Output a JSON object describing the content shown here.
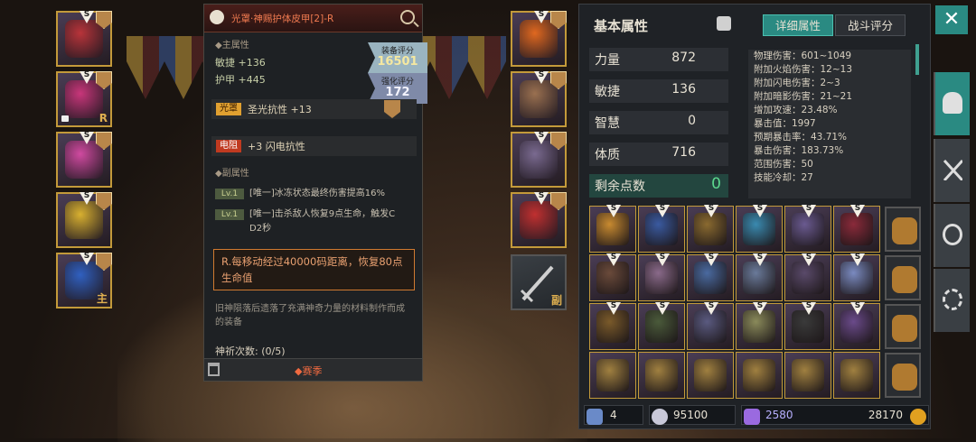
{
  "equipped_left": [
    {
      "name": "helmet",
      "badge": "S",
      "shield": true,
      "color": "#b8343a",
      "locked": false,
      "tag": ""
    },
    {
      "name": "armor",
      "badge": "S",
      "shield": true,
      "color": "#c8367a",
      "locked": true,
      "tag": "R"
    },
    {
      "name": "robe",
      "badge": "S",
      "shield": true,
      "color": "#d04aa0",
      "locked": false,
      "tag": ""
    },
    {
      "name": "axe",
      "badge": "S",
      "shield": true,
      "color": "#d8b030",
      "locked": false,
      "tag": ""
    },
    {
      "name": "mace",
      "badge": "S",
      "shield": true,
      "color": "#3060c0",
      "locked": false,
      "tag": "主"
    }
  ],
  "equipped_right": [
    {
      "name": "amulet",
      "badge": "S",
      "shield": true,
      "color": "#e06820"
    },
    {
      "name": "gloves",
      "badge": "S",
      "shield": true,
      "color": "#9a7050"
    },
    {
      "name": "boots",
      "badge": "S",
      "shield": true,
      "color": "#7a6a90"
    },
    {
      "name": "ring",
      "badge": "S",
      "shield": true,
      "color": "#c03030"
    }
  ],
  "offhand": {
    "tag": "副"
  },
  "tooltip": {
    "title": "光罩·神赐护体皮甲[2]-R",
    "main_section": "◆主属性",
    "stat1": "敏捷 +136",
    "stat2": "护甲 +445",
    "score_label": "装备评分",
    "score_value": "16501",
    "enhance_label": "强化评分",
    "enhance_value": "172",
    "row1_pill": "光罩",
    "row1_text": "圣光抗性 +13",
    "row2_pill": "电阻",
    "row2_text": "+3 闪电抗性",
    "sub_section": "◆副属性",
    "lv_label": "Lv.1",
    "sub1": "[唯一]冰冻状态最终伤害提高16%",
    "sub2a": "[唯一]击杀敌人恢复9点生命，触发C",
    "sub2b": "D2秒",
    "special": "R.每移动经过40000码距离，恢复80点生命值",
    "flavor": "旧神陨落后遗落了充满神奇力量的材料制作而成的装备",
    "pray": "神祈次数: (0/5)",
    "season": "◆赛季"
  },
  "panel": {
    "title": "基本属性",
    "tab_detail": "详细属性",
    "tab_battle": "战斗评分",
    "attrs": [
      {
        "name": "力量",
        "value": "872"
      },
      {
        "name": "敏捷",
        "value": "136"
      },
      {
        "name": "智慧",
        "value": "0"
      },
      {
        "name": "体质",
        "value": "716"
      }
    ],
    "remaining_label": "剩余点数",
    "remaining_value": "0",
    "details": [
      "物理伤害：601~1049",
      "附加火焰伤害：12~13",
      "附加闪电伤害：2~3",
      "附加暗影伤害：21~21",
      "增加攻速：23.48%",
      "暴击值：1997",
      "预期暴击率：43.71%",
      "暴击伤害：183.73%",
      "范围伤害：50",
      "技能冷却：27"
    ],
    "bottom": {
      "hammer": "4",
      "silver": "95100",
      "crystal": "2580",
      "gold": "28170"
    }
  },
  "inventory_colors": [
    [
      "#c88a30",
      "#3a5aa0",
      "#8a6a30",
      "#3a8ab0",
      "#6a5a90",
      "#8a2a3a"
    ],
    [
      "#6a4a3a",
      "#8a6a8a",
      "#4a6aa0",
      "#6a7a9a",
      "#5a4a6a",
      "#7a8ac0"
    ],
    [
      "#7a5a2a",
      "#4a5a3a",
      "#5a5a80",
      "#8a8a5a",
      "#3a3a3a",
      "#6a4a8a"
    ],
    [
      "#a08040",
      "#a08040",
      "#a08040",
      "#a08040",
      "#a08040",
      "#a08040"
    ]
  ],
  "colors": {
    "accent": "#2a8a82",
    "gold": "#c39a3a",
    "orange": "#f07a50"
  }
}
